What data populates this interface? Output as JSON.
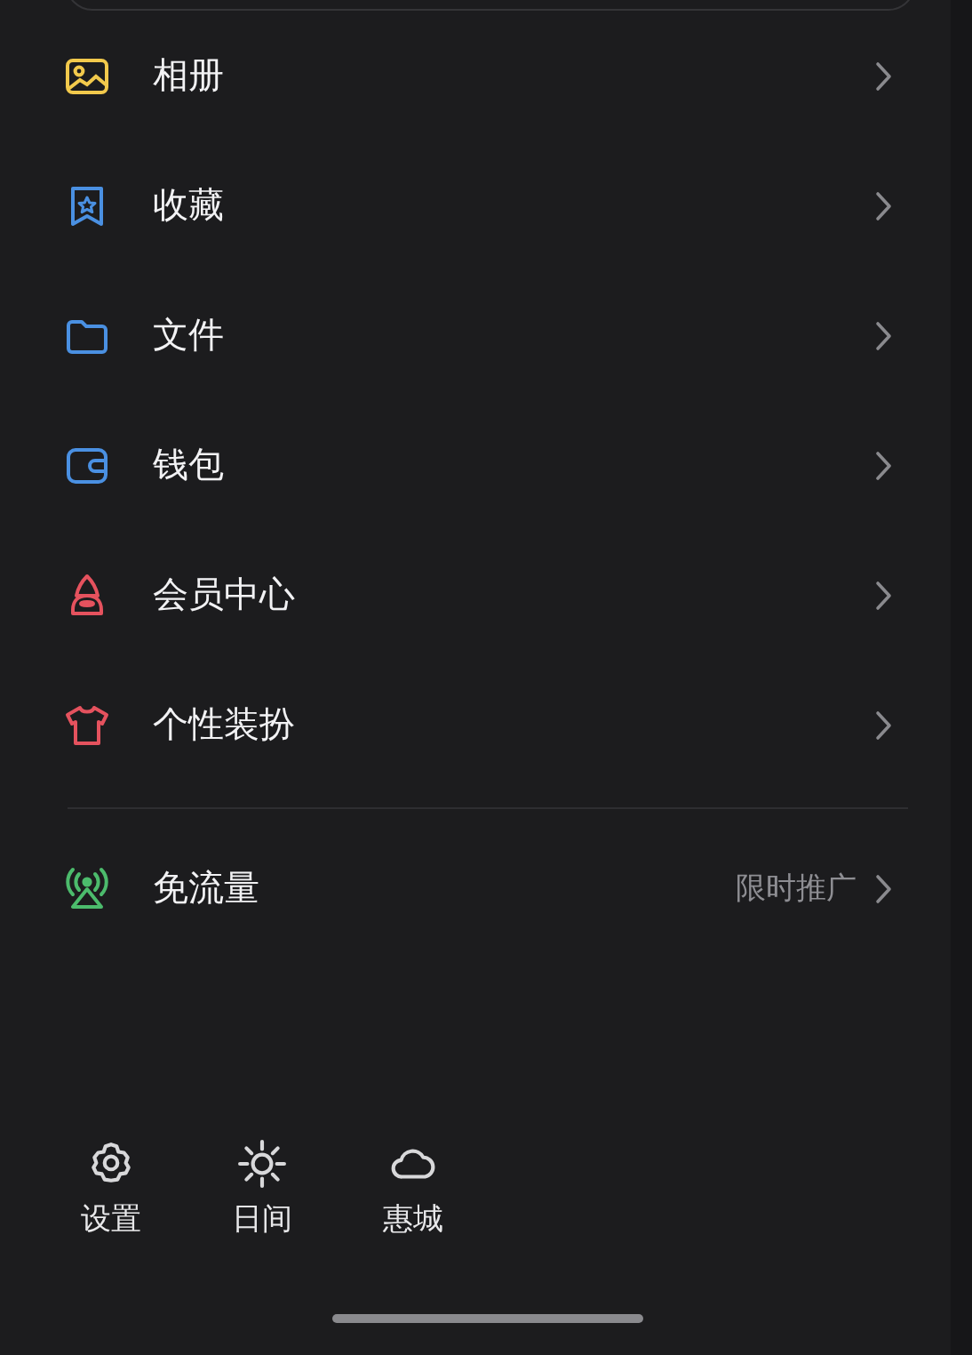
{
  "menu": [
    {
      "label": "相册",
      "color": "#f2c94c"
    },
    {
      "label": "收藏",
      "color": "#4a90e2"
    },
    {
      "label": "文件",
      "color": "#4a90e2"
    },
    {
      "label": "钱包",
      "color": "#4a90e2"
    },
    {
      "label": "会员中心",
      "color": "#e5525e"
    },
    {
      "label": "个性装扮",
      "color": "#e5525e"
    }
  ],
  "promo": {
    "label": "免流量",
    "color": "#4cbb6c",
    "badge": "限时推广"
  },
  "tools": [
    {
      "label": "设置"
    },
    {
      "label": "日间"
    },
    {
      "label": "惠城"
    }
  ]
}
